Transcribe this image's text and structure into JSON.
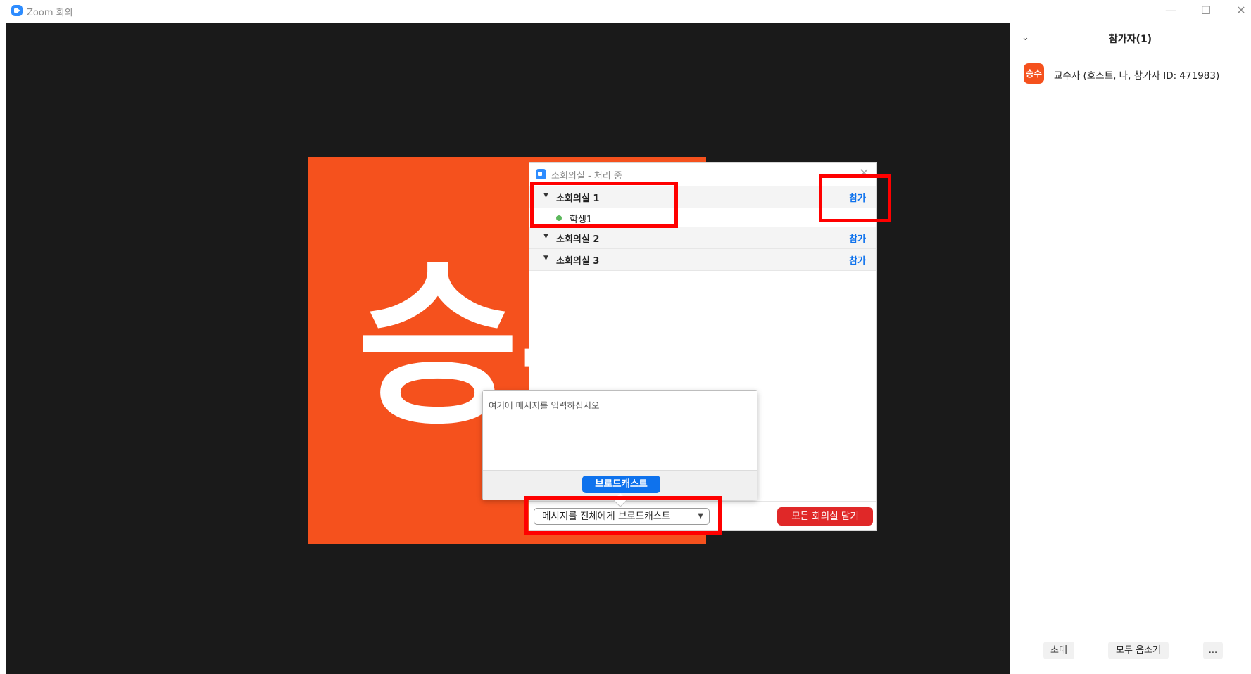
{
  "window": {
    "title": "Zoom 회의",
    "minimize_label": "—",
    "maximize_label": "☐",
    "close_label": "✕"
  },
  "video": {
    "avatar_text": "승수"
  },
  "breakout_dialog": {
    "title": "소회의실 - 처리 중",
    "close_label": "✕",
    "rooms": [
      {
        "name": "소회의실 1",
        "join_label": "참가",
        "members": [
          "학생1"
        ]
      },
      {
        "name": "소회의실 2",
        "join_label": "참가",
        "members": []
      },
      {
        "name": "소회의실 3",
        "join_label": "참가",
        "members": []
      }
    ],
    "broadcast_dropdown_label": "메시지를 전체에게 브로드캐스트",
    "close_all_label": "모든 회의실 닫기"
  },
  "broadcast_popup": {
    "placeholder": "여기에 메시지를 입력하십시오",
    "button_label": "브로드캐스트"
  },
  "participants_panel": {
    "title": "참가자(1)",
    "collapse_icon": "chevron-down-icon",
    "participants": [
      {
        "avatar": "승수",
        "name": "교수자 (호스트, 나, 참가자 ID: 471983)"
      }
    ],
    "invite_label": "초대",
    "mute_all_label": "모두 음소거",
    "more_label": "..."
  },
  "colors": {
    "accent": "#0e72ed",
    "avatar": "#f5511d",
    "danger": "#e02828",
    "highlight": "#ff0000",
    "online": "#5cb85c"
  }
}
